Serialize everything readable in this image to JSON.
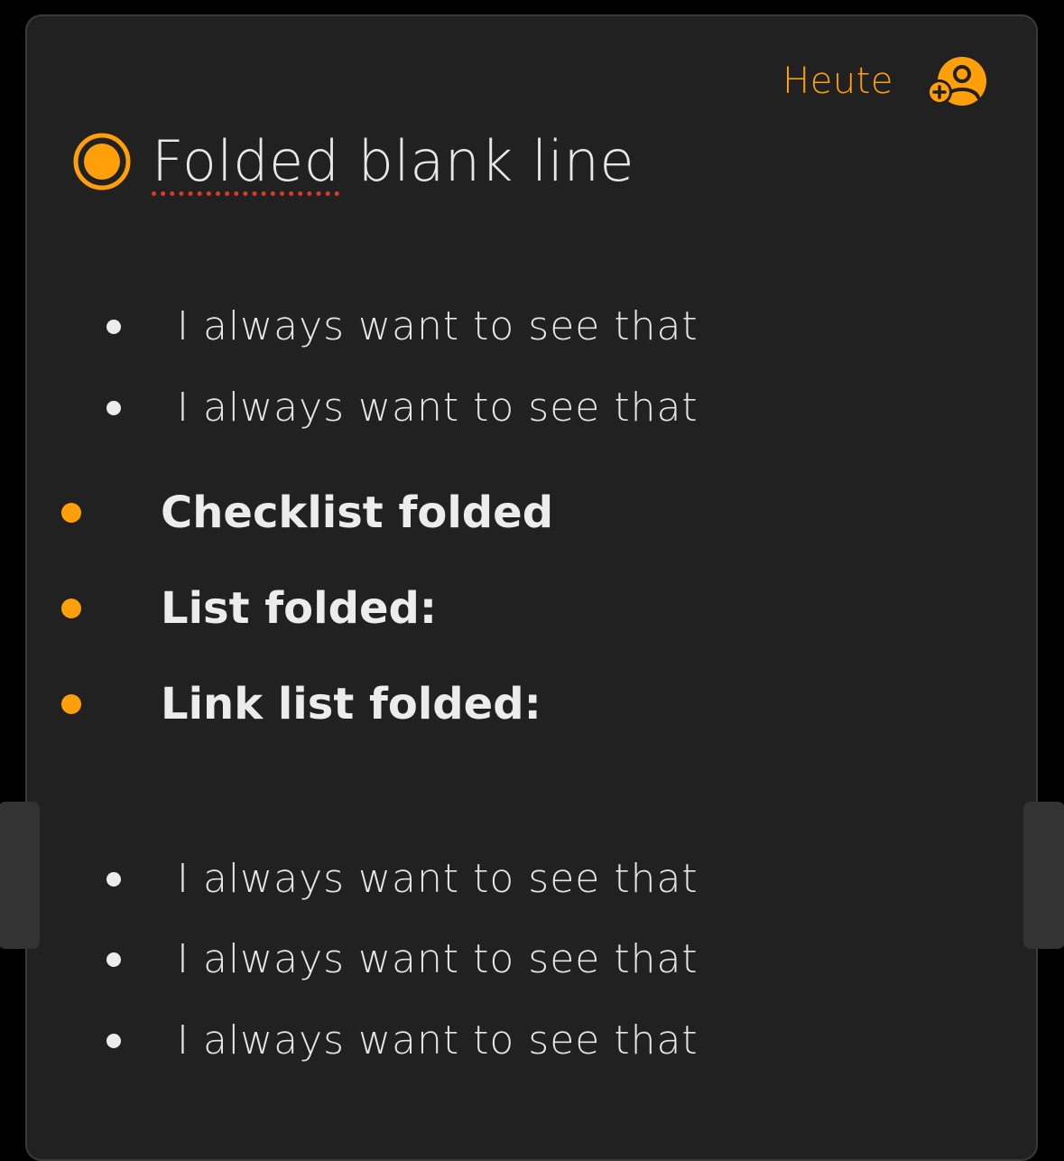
{
  "header": {
    "today_label": "Heute",
    "share_icon": "person-add-icon"
  },
  "colors": {
    "accent": "#ff9f0a",
    "background": "#212121",
    "text": "#e6e6e6",
    "spell_error": "#e0392b"
  },
  "note": {
    "icon": "radio-dot-icon",
    "title_misspelled": "Folded",
    "title_rest": " blank line"
  },
  "list_top": [
    "I always want to see that",
    "I always want to see that"
  ],
  "folded_sections": [
    "Checklist folded",
    "List folded:",
    "Link list folded:"
  ],
  "list_bottom": [
    "I always want to see that",
    "I always want to see that",
    "I always want to see that"
  ]
}
